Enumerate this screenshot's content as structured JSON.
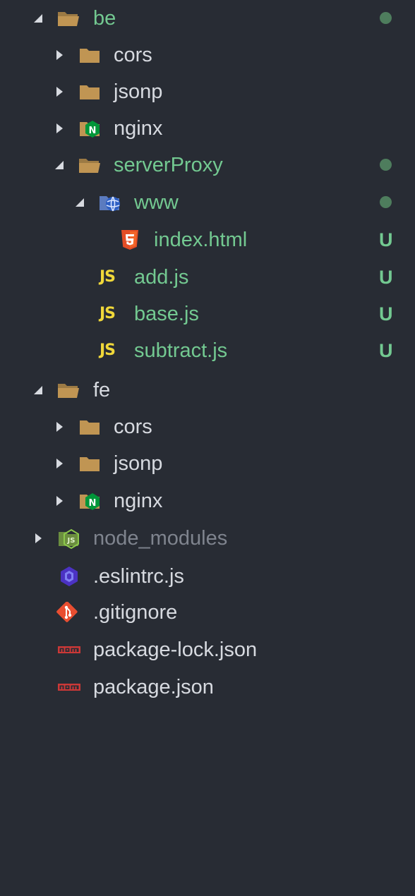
{
  "explorer": {
    "colors": {
      "background": "#282c34",
      "folder": "#c09553",
      "git_added_text": "#73c991",
      "git_dot": "#4e7d5d",
      "js_icon": "#f0d83a",
      "html_icon": "#e44d26",
      "nginx_icon": "#009639",
      "npm_icon": "#cb3837",
      "git_icon": "#e94e31",
      "eslint_icon": "#4b32c3",
      "ignored_text": "#7f848e"
    },
    "items": [
      {
        "label": "be",
        "kind": "folder",
        "expanded": true,
        "icon": "folder-open-icon",
        "git": "dot"
      },
      {
        "label": "cors",
        "kind": "folder",
        "expanded": false,
        "icon": "folder-icon"
      },
      {
        "label": "jsonp",
        "kind": "folder",
        "expanded": false,
        "icon": "folder-icon"
      },
      {
        "label": "nginx",
        "kind": "folder",
        "expanded": false,
        "icon": "nginx-folder-icon"
      },
      {
        "label": "serverProxy",
        "kind": "folder",
        "expanded": true,
        "icon": "folder-open-icon",
        "git": "dot"
      },
      {
        "label": "www",
        "kind": "folder",
        "expanded": true,
        "icon": "www-folder-icon",
        "git": "dot"
      },
      {
        "label": "index.html",
        "kind": "file",
        "icon": "html5-icon",
        "git": "U"
      },
      {
        "label": "add.js",
        "kind": "file",
        "icon": "javascript-icon",
        "git": "U"
      },
      {
        "label": "base.js",
        "kind": "file",
        "icon": "javascript-icon",
        "git": "U"
      },
      {
        "label": "subtract.js",
        "kind": "file",
        "icon": "javascript-icon",
        "git": "U"
      },
      {
        "label": "fe",
        "kind": "folder",
        "expanded": true,
        "icon": "folder-open-icon"
      },
      {
        "label": "cors",
        "kind": "folder",
        "expanded": false,
        "icon": "folder-icon"
      },
      {
        "label": "jsonp",
        "kind": "folder",
        "expanded": false,
        "icon": "folder-icon"
      },
      {
        "label": "nginx",
        "kind": "folder",
        "expanded": false,
        "icon": "nginx-folder-icon"
      },
      {
        "label": "node_modules",
        "kind": "folder",
        "expanded": false,
        "icon": "node-folder-icon"
      },
      {
        "label": ".eslintrc.js",
        "kind": "file",
        "icon": "eslint-icon"
      },
      {
        "label": ".gitignore",
        "kind": "file",
        "icon": "git-icon"
      },
      {
        "label": "package-lock.json",
        "kind": "file",
        "icon": "npm-icon"
      },
      {
        "label": "package.json",
        "kind": "file",
        "icon": "npm-icon"
      }
    ]
  }
}
